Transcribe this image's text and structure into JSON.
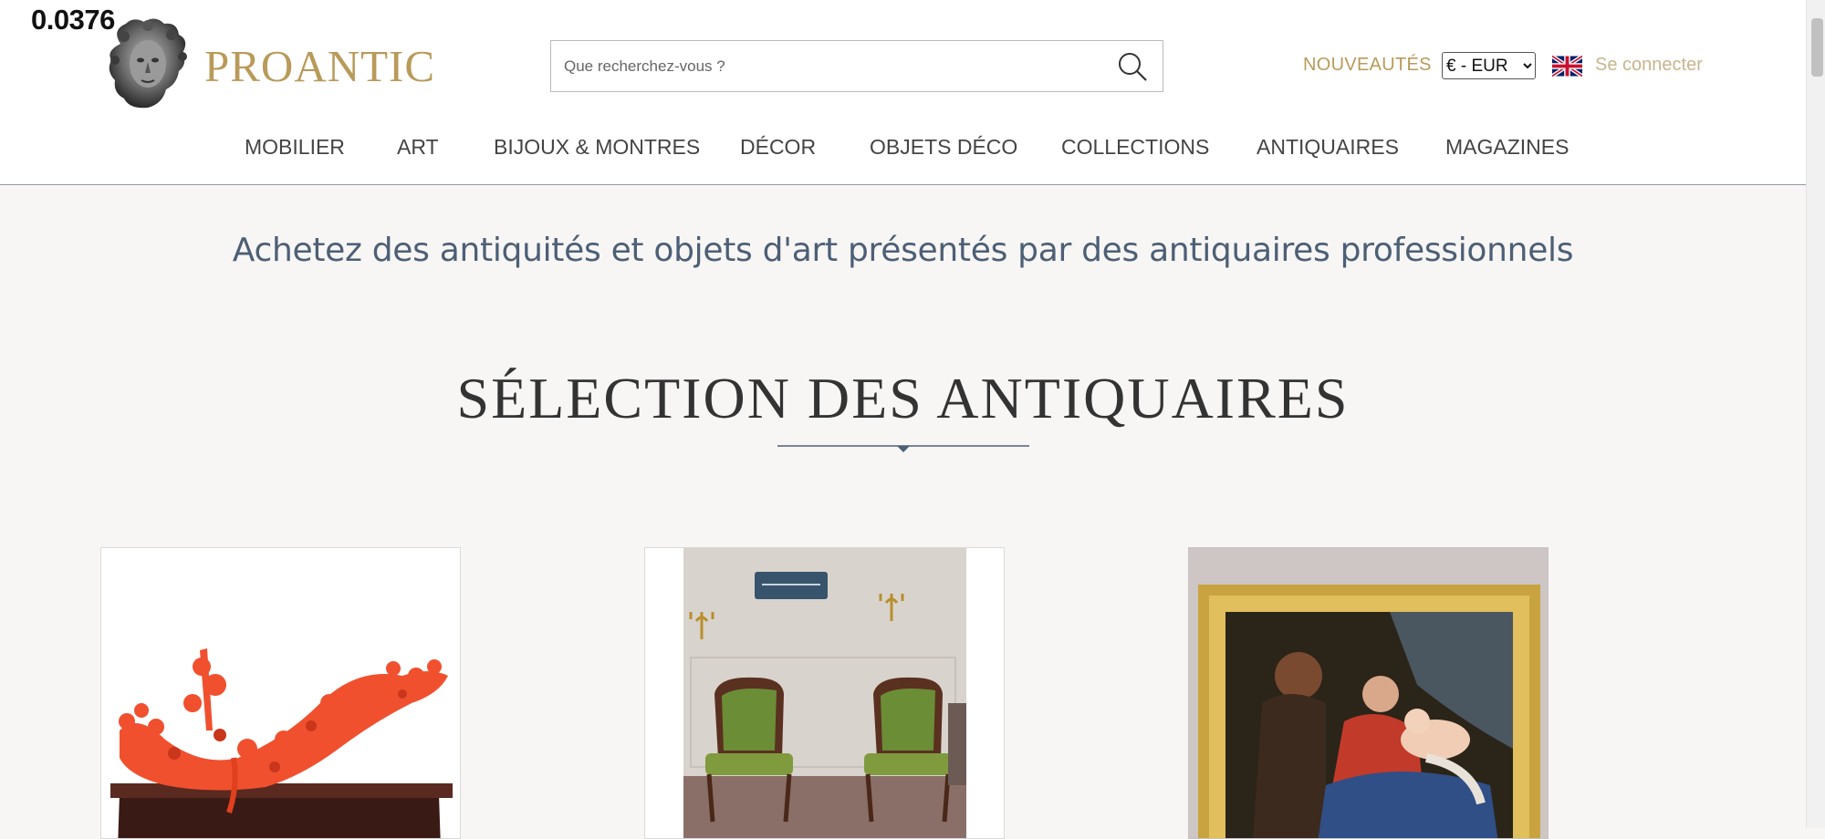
{
  "overlay": {
    "score": "0.0376"
  },
  "header": {
    "brand": "PROANTIC",
    "search_placeholder": "Que recherchez-vous ?",
    "nouveautes": "NOUVEAUTÉS",
    "currency": {
      "selected": "€ - EUR"
    },
    "language_icon": "uk-flag-icon",
    "login": "Se connecter"
  },
  "nav": {
    "items": [
      {
        "label": "MOBILIER"
      },
      {
        "label": "ART"
      },
      {
        "label": "BIJOUX & MONTRES"
      },
      {
        "label": "DÉCOR"
      },
      {
        "label": "OBJETS DÉCO"
      },
      {
        "label": "COLLECTIONS"
      },
      {
        "label": "ANTIQUAIRES"
      },
      {
        "label": "MAGAZINES"
      }
    ]
  },
  "main": {
    "tagline": "Achetez des antiquités et objets d'art présentés par des antiquaires professionnels",
    "section_title": "SÉLECTION DES ANTIQUAIRES"
  },
  "cards": [
    {
      "image": "red coral sculpture on wooden stand"
    },
    {
      "image": "pair of upholstered armchairs"
    },
    {
      "image": "framed old master painting"
    }
  ],
  "colors": {
    "brand_gold": "#b99a5a",
    "login_gold": "#c9b48c",
    "tagline_blue": "#4d5f76",
    "background": "#f7f6f4"
  }
}
